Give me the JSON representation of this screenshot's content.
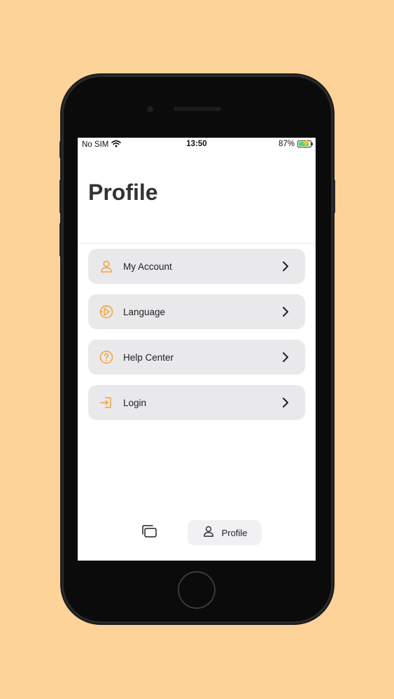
{
  "status_bar": {
    "carrier": "No SIM",
    "time": "13:50",
    "battery": "87%",
    "wifi_icon": "wifi-icon",
    "battery_icon": "battery-charging-icon"
  },
  "page": {
    "title": "Profile"
  },
  "menu": [
    {
      "label": "My Account",
      "icon": "user-icon"
    },
    {
      "label": "Language",
      "icon": "language-globe-icon"
    },
    {
      "label": "Help Center",
      "icon": "help-circle-icon"
    },
    {
      "label": "Login",
      "icon": "login-icon"
    }
  ],
  "tabbar": {
    "home_icon": "cards-icon",
    "profile_label": "Profile",
    "profile_icon": "user-icon"
  },
  "colors": {
    "background": "#FDD39A",
    "accent": "#F2A33A",
    "menu_item_bg": "#E9E8EA",
    "title": "#333333"
  }
}
